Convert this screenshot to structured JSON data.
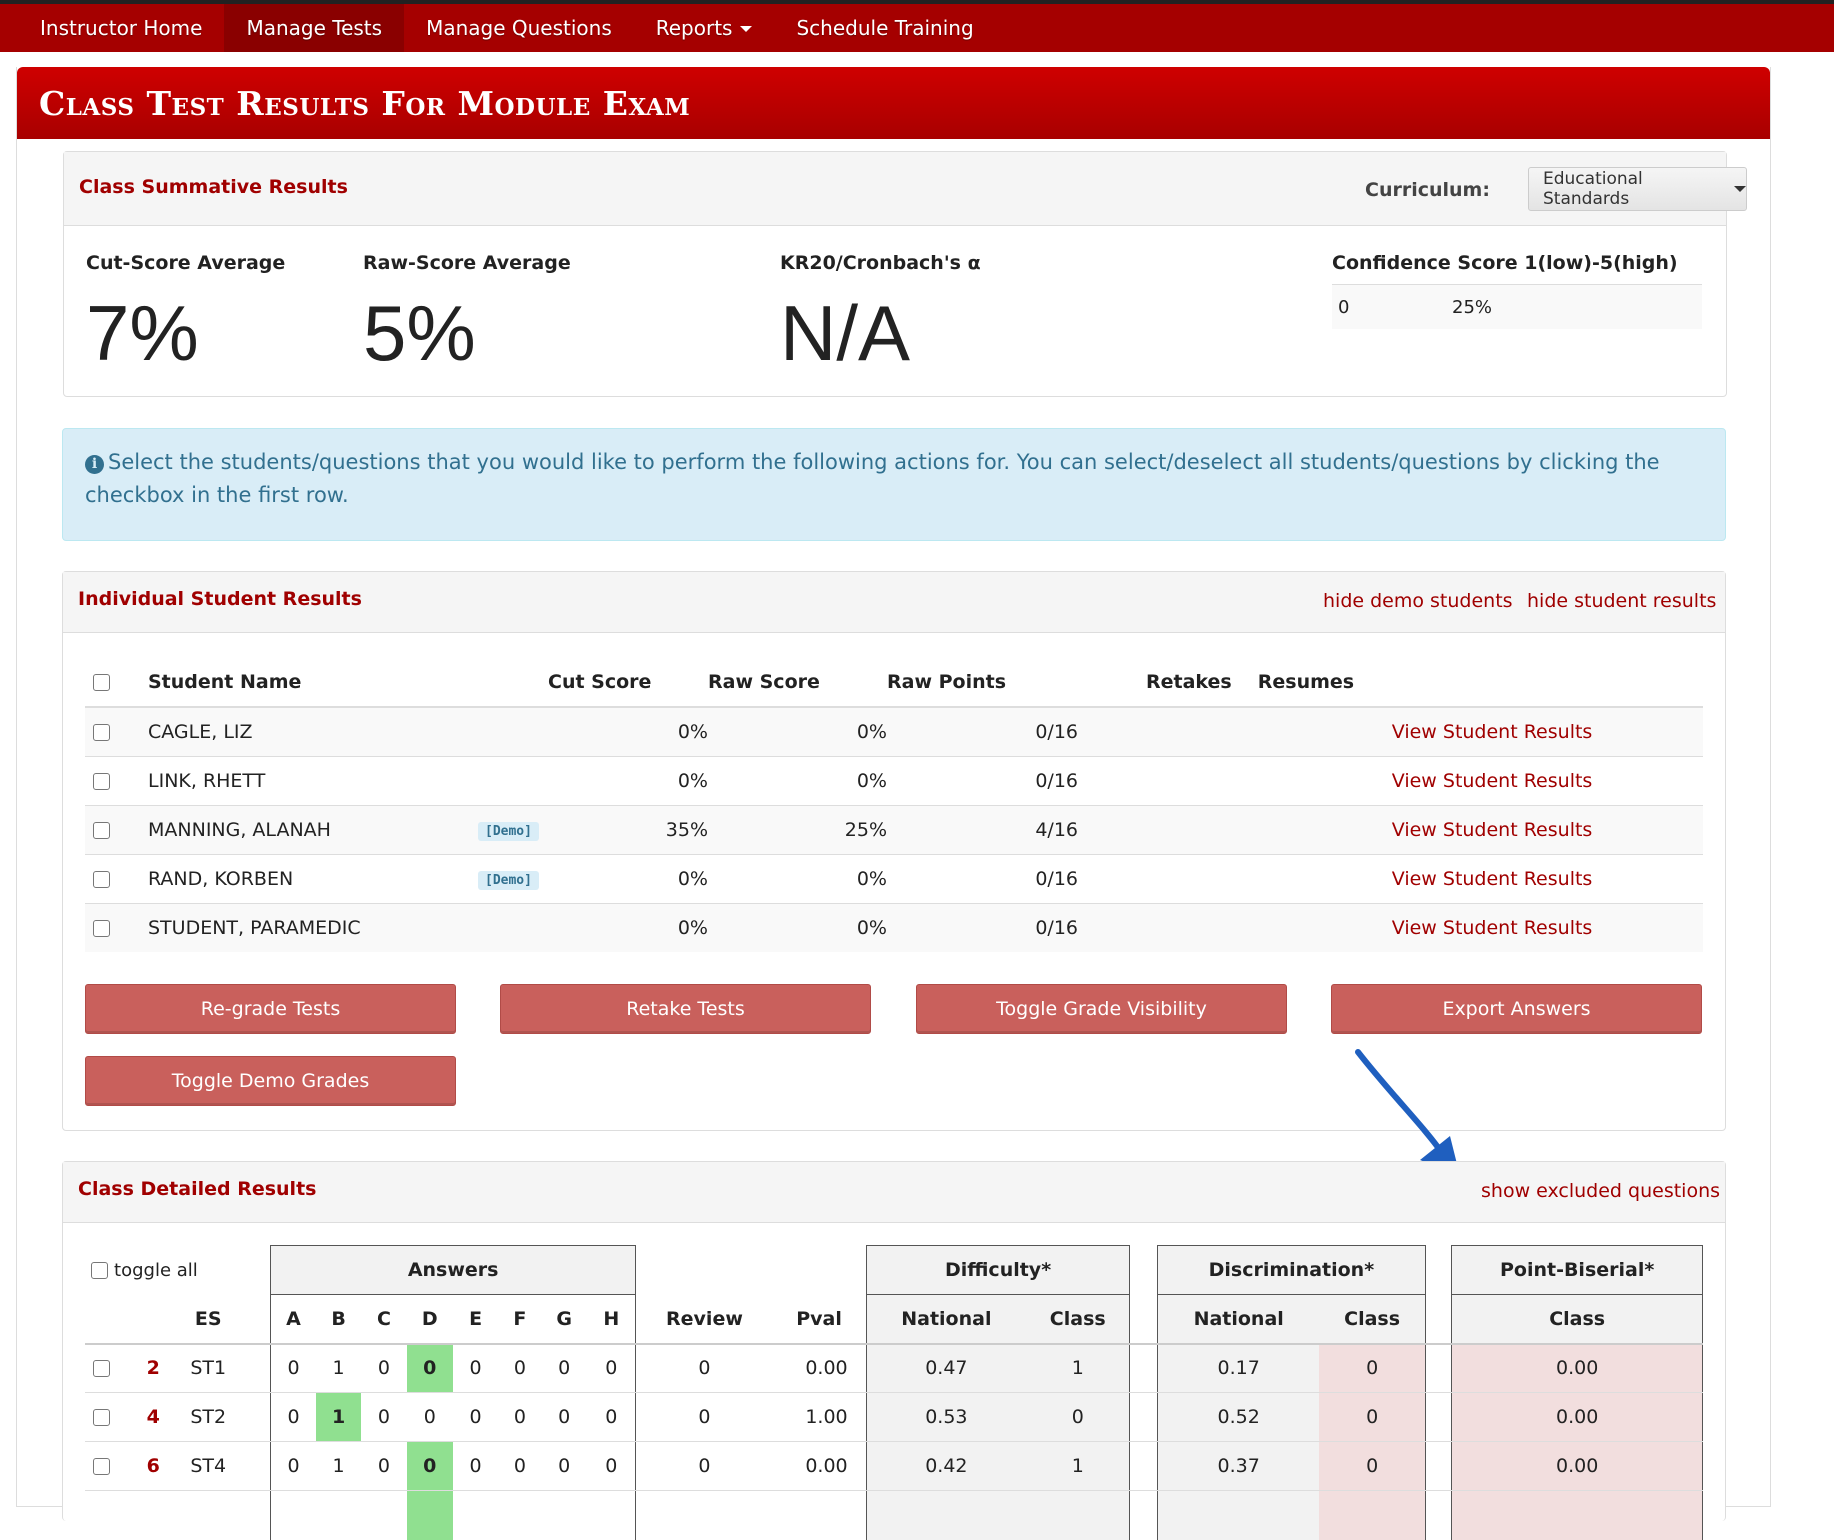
{
  "nav": {
    "items": [
      {
        "label": "Instructor Home",
        "active": false
      },
      {
        "label": "Manage Tests",
        "active": true
      },
      {
        "label": "Manage Questions",
        "active": false
      },
      {
        "label": "Reports",
        "active": false,
        "dropdown": true
      },
      {
        "label": "Schedule Training",
        "active": false
      }
    ]
  },
  "page_title": "Class Test Results For Module Exam",
  "summary": {
    "title": "Class Summative Results",
    "curriculum_label": "Curriculum:",
    "curriculum_value": "Educational Standards",
    "cut_score_label": "Cut-Score Average",
    "cut_score_value": "7%",
    "raw_score_label": "Raw-Score Average",
    "raw_score_value": "5%",
    "kr20_label": "KR20/Cronbach's α",
    "kr20_value": "N/A",
    "confidence_label": "Confidence Score 1(low)-5(high)",
    "confidence_col1": "0",
    "confidence_col2": "25%"
  },
  "alert": {
    "text": "Select the students/questions that you would like to perform the following actions for. You can select/deselect all students/questions by clicking the checkbox in the first row."
  },
  "students": {
    "title": "Individual Student Results",
    "hide_demo_label": "hide demo students",
    "hide_results_label": "hide student results",
    "columns": {
      "name": "Student Name",
      "cut": "Cut Score",
      "raw": "Raw Score",
      "points": "Raw Points",
      "retakes": "Retakes",
      "resumes": "Resumes"
    },
    "view_label": "View Student Results",
    "demo_badge": "[Demo]",
    "rows": [
      {
        "name": "CAGLE, LIZ",
        "demo": false,
        "cut": "0%",
        "raw": "0%",
        "points": "0/16"
      },
      {
        "name": "LINK, RHETT",
        "demo": false,
        "cut": "0%",
        "raw": "0%",
        "points": "0/16"
      },
      {
        "name": "MANNING, ALANAH",
        "demo": true,
        "cut": "35%",
        "raw": "25%",
        "points": "4/16"
      },
      {
        "name": "RAND, KORBEN",
        "demo": true,
        "cut": "0%",
        "raw": "0%",
        "points": "0/16"
      },
      {
        "name": "STUDENT, PARAMEDIC",
        "demo": false,
        "cut": "0%",
        "raw": "0%",
        "points": "0/16"
      }
    ],
    "buttons": {
      "regrade": "Re-grade Tests",
      "retake": "Retake Tests",
      "toggle_visibility": "Toggle Grade Visibility",
      "export": "Export Answers",
      "toggle_demo": "Toggle Demo Grades"
    }
  },
  "detail": {
    "title": "Class Detailed Results",
    "show_excluded_label": "show excluded questions",
    "toggle_all_label": "toggle all",
    "group_headers": {
      "answers": "Answers",
      "difficulty": "Difficulty*",
      "discrimination": "Discrimination*",
      "point_biserial": "Point-Biserial*"
    },
    "columns": {
      "es": "ES",
      "answer_letters": [
        "A",
        "B",
        "C",
        "D",
        "E",
        "F",
        "G",
        "H"
      ],
      "review": "Review",
      "pval": "Pval",
      "national": "National",
      "class": "Class"
    },
    "rows": [
      {
        "num": "2",
        "es": "ST1",
        "answers": [
          "0",
          "1",
          "0",
          "0",
          "0",
          "0",
          "0",
          "0"
        ],
        "correct_index": 3,
        "review": "0",
        "pval": "0.00",
        "diff_national": "0.47",
        "diff_class": "1",
        "disc_national": "0.17",
        "disc_class": "0",
        "pb_class": "0.00"
      },
      {
        "num": "4",
        "es": "ST2",
        "answers": [
          "0",
          "1",
          "0",
          "0",
          "0",
          "0",
          "0",
          "0"
        ],
        "correct_index": 1,
        "review": "0",
        "pval": "1.00",
        "diff_national": "0.53",
        "diff_class": "0",
        "disc_national": "0.52",
        "disc_class": "0",
        "pb_class": "0.00"
      },
      {
        "num": "6",
        "es": "ST4",
        "answers": [
          "0",
          "1",
          "0",
          "0",
          "0",
          "0",
          "0",
          "0"
        ],
        "correct_index": 3,
        "review": "0",
        "pval": "0.00",
        "diff_national": "0.42",
        "diff_class": "1",
        "disc_national": "0.37",
        "disc_class": "0",
        "pb_class": "0.00"
      }
    ]
  }
}
